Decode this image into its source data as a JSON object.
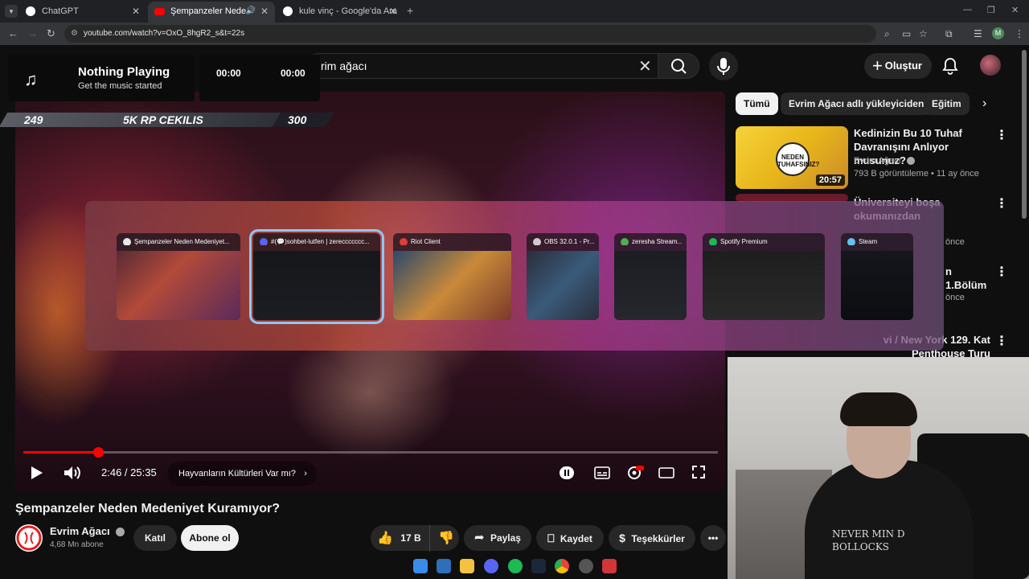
{
  "browser": {
    "tabs": [
      {
        "title": "ChatGPT",
        "active": false
      },
      {
        "title": "Şempanzeler Neden Medeniyet",
        "active": true
      },
      {
        "title": "kule vinç - Google'da Ara",
        "active": false
      }
    ],
    "url": "youtube.com/watch?v=OxO_8hgR2_s&t=22s",
    "profile_initial": "M"
  },
  "youtube_header": {
    "search_value": "rim ağacı",
    "create_label": "Oluştur"
  },
  "music_widget": {
    "title": "Nothing Playing",
    "subtitle": "Get the music started",
    "time_current": "00:00",
    "time_total": "00:00"
  },
  "stream_banner": {
    "left_value": "249",
    "label": "5K RP CEKILIS",
    "right_value": "300"
  },
  "player": {
    "progress_fraction": 0.108,
    "time_display": "2:46 / 25:35",
    "chapter": "Hayvanların Kültürleri Var mı?"
  },
  "switcher": {
    "windows": [
      {
        "title": "Şempanzeler Neden Medeniyet...",
        "app_color": "#e8e8e8"
      },
      {
        "title": "#(💬)sohbet-lutfen | zereccccccc...",
        "app_color": "#5865f2",
        "selected": true
      },
      {
        "title": "Riot Client",
        "app_color": "#e23b3b"
      },
      {
        "title": "OBS 32.0.1 - Pr...",
        "app_color": "#cccccc"
      },
      {
        "title": "zeresha Stream...",
        "app_color": "#4caf50"
      },
      {
        "title": "Spotify Premium",
        "app_color": "#1db954"
      },
      {
        "title": "Steam",
        "app_color": "#66c0f4"
      }
    ]
  },
  "sidebar": {
    "chips": [
      {
        "label": "Tümü",
        "active": true
      },
      {
        "label": "Evrim Ağacı adlı yükleyiciden",
        "active": false
      },
      {
        "label": "Eğitim",
        "active": false
      }
    ],
    "recommendations": [
      {
        "title": "Kedinizin Bu 10 Tuhaf Davranışını Anlıyor musunuz?",
        "channel": "Evrim Ağacı",
        "meta": "793 B görüntüleme • 11 ay önce",
        "duration": "20:57",
        "thumb_text": "NEDEN TUHAFSINIZ?"
      },
      {
        "title": "Üniversiteyi boşa okumanızdan",
        "meta_partial": "önce"
      },
      {
        "title": "n 1.Bölüm",
        "meta_partial": "önce"
      },
      {
        "title": "vi / New York 129. Kat Penthouse Turu"
      }
    ]
  },
  "video_info": {
    "title": "Şempanzeler Neden Medeniyet Kuramıyor?",
    "channel_name": "Evrim Ağacı",
    "subscribers": "4,68 Mn abone",
    "join_label": "Katıl",
    "subscribe_label": "Abone ol",
    "likes": "17 B",
    "share_label": "Paylaş",
    "save_label": "Kaydet",
    "thanks_label": "Teşekkürler",
    "webcam_shirt_text": "NEVER MIN D BOLLOCKS"
  }
}
